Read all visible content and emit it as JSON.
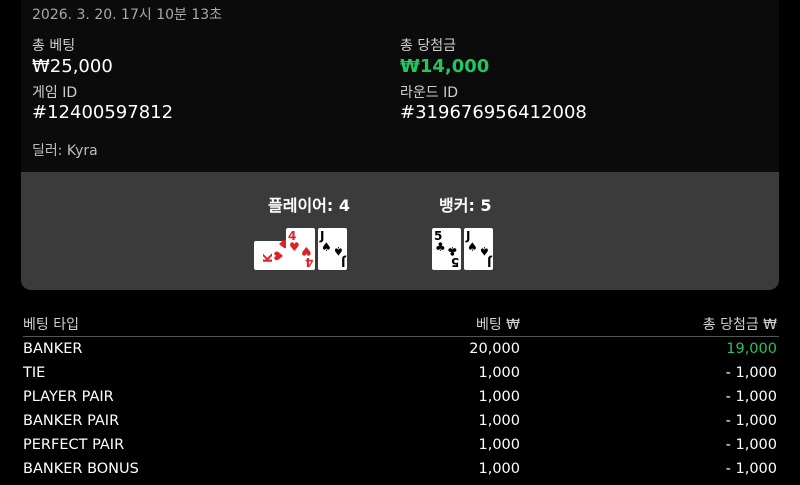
{
  "header": {
    "timestamp": "2026. 3. 20. 17시 10분 13초",
    "total_bet_label": "총 베팅",
    "total_bet_value": "₩25,000",
    "total_win_label": "총 당첨금",
    "total_win_value": "₩14,000",
    "game_id_label": "게임 ID",
    "game_id_value": "#12400597812",
    "round_id_label": "라운드 ID",
    "round_id_value": "#319676956412008",
    "dealer": "딜러: Kyra"
  },
  "hands": {
    "player_label": "플레이어: 4",
    "banker_label": "뱅커: 5",
    "player_cards": [
      {
        "rank": "K",
        "suit": "♥",
        "color": "red",
        "rotated": true
      },
      {
        "rank": "4",
        "suit": "♥",
        "color": "red",
        "rotated": false
      },
      {
        "rank": "J",
        "suit": "♠",
        "color": "black",
        "rotated": false
      }
    ],
    "banker_cards": [
      {
        "rank": "5",
        "suit": "♣",
        "color": "black",
        "rotated": false
      },
      {
        "rank": "J",
        "suit": "♠",
        "color": "black",
        "rotated": false
      }
    ]
  },
  "table": {
    "headers": [
      "베팅 타입",
      "베팅 ₩",
      "총 당첨금 ₩"
    ],
    "rows": [
      {
        "type": "BANKER",
        "bet": "20,000",
        "win": "19,000",
        "win_positive": true
      },
      {
        "type": "TIE",
        "bet": "1,000",
        "win": "- 1,000",
        "win_positive": false
      },
      {
        "type": "PLAYER PAIR",
        "bet": "1,000",
        "win": "- 1,000",
        "win_positive": false
      },
      {
        "type": "BANKER PAIR",
        "bet": "1,000",
        "win": "- 1,000",
        "win_positive": false
      },
      {
        "type": "PERFECT PAIR",
        "bet": "1,000",
        "win": "- 1,000",
        "win_positive": false
      },
      {
        "type": "BANKER BONUS",
        "bet": "1,000",
        "win": "- 1,000",
        "win_positive": false
      }
    ]
  },
  "colors": {
    "win": "#22c55e",
    "panel": "#3b3b3b",
    "background": "#000000"
  }
}
